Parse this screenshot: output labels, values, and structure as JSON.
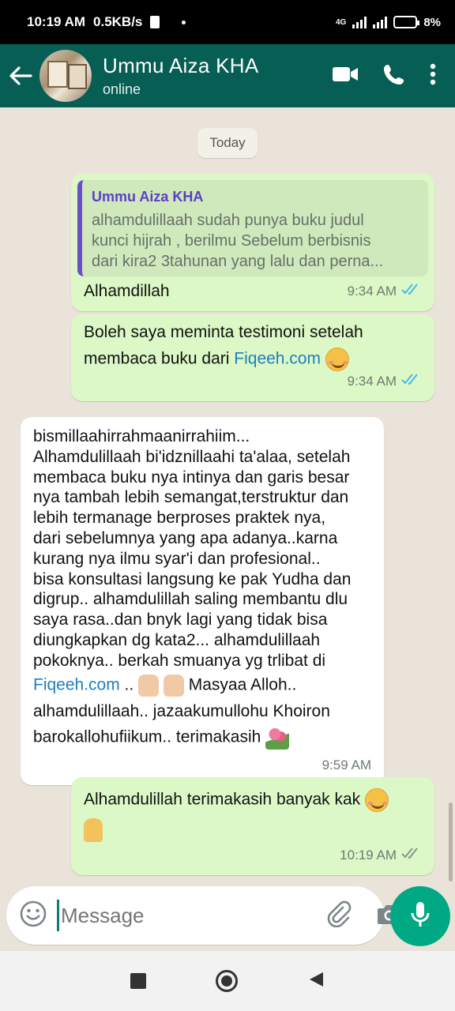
{
  "status_bar": {
    "time": "10:19 AM",
    "net_speed": "0.5KB/s",
    "network": "4G",
    "battery": "8%"
  },
  "header": {
    "name": "Ummu Aiza KHA",
    "status": "online",
    "icons": [
      "back-arrow-icon",
      "video-call-icon",
      "phone-icon",
      "more-vert-icon"
    ]
  },
  "chat": {
    "date_chip": "Today",
    "messages": [
      {
        "direction": "out",
        "quote": {
          "author": "Ummu Aiza KHA",
          "lines": [
            "alhamdulillaah sudah punya buku judul",
            "kunci hijrah , berilmu Sebelum berbisnis",
            "dari kira2  3tahunan yang lalu dan perna..."
          ]
        },
        "text": "Alhamdillah",
        "time": "9:34 AM",
        "read": true
      },
      {
        "direction": "out",
        "line1": "Boleh saya meminta testimoni setelah",
        "line2_prefix": "membaca buku dari ",
        "link": "Fiqeeh.com",
        "time": "9:34 AM",
        "read": true
      },
      {
        "direction": "in",
        "lines": [
          "bismillaahirrahmaanirrahiim...",
          "Alhamdulillaah bi'idznillaahi ta'alaa, setelah",
          "membaca buku nya intinya dan garis besar",
          "nya tambah lebih semangat,terstruktur dan",
          "lebih termanage  berproses praktek nya,",
          "dari sebelumnya yang apa adanya..karna",
          "kurang nya ilmu syar'i dan profesional..",
          "bisa konsultasi langsung ke pak Yudha dan",
          "digrup.. alhamdulillah saling membantu dlu",
          "saya rasa..dan bnyk lagi yang tidak bisa",
          "diungkapkan dg kata2... alhamdulillaah",
          "pokoknya.. berkah smuanya yg trlibat di"
        ],
        "link": "Fiqeeh.com",
        "after_link": " .. ",
        "after_thumbs": " Masyaa Alloh..",
        "line_b": "alhamdulillaah.. jazaakumullohu Khoiron",
        "line_c": "barokallohufiikum.. terimakasih ",
        "time": "9:59 AM"
      },
      {
        "direction": "out",
        "text": "Alhamdulillah terimakasih banyak kak ",
        "time": "10:19 AM",
        "read": false
      }
    ]
  },
  "composer": {
    "placeholder": "Message",
    "icons": [
      "emoji-icon",
      "attach-icon",
      "camera-icon",
      "mic-icon"
    ]
  },
  "colors": {
    "header": "#075e54",
    "outgoing_bubble": "#dcf8c6",
    "incoming_bubble": "#ffffff",
    "chat_background": "#e9e3da",
    "link": "#1f7fbf",
    "mic_button": "#00a884",
    "read_ticks": "#4fb6ec"
  }
}
